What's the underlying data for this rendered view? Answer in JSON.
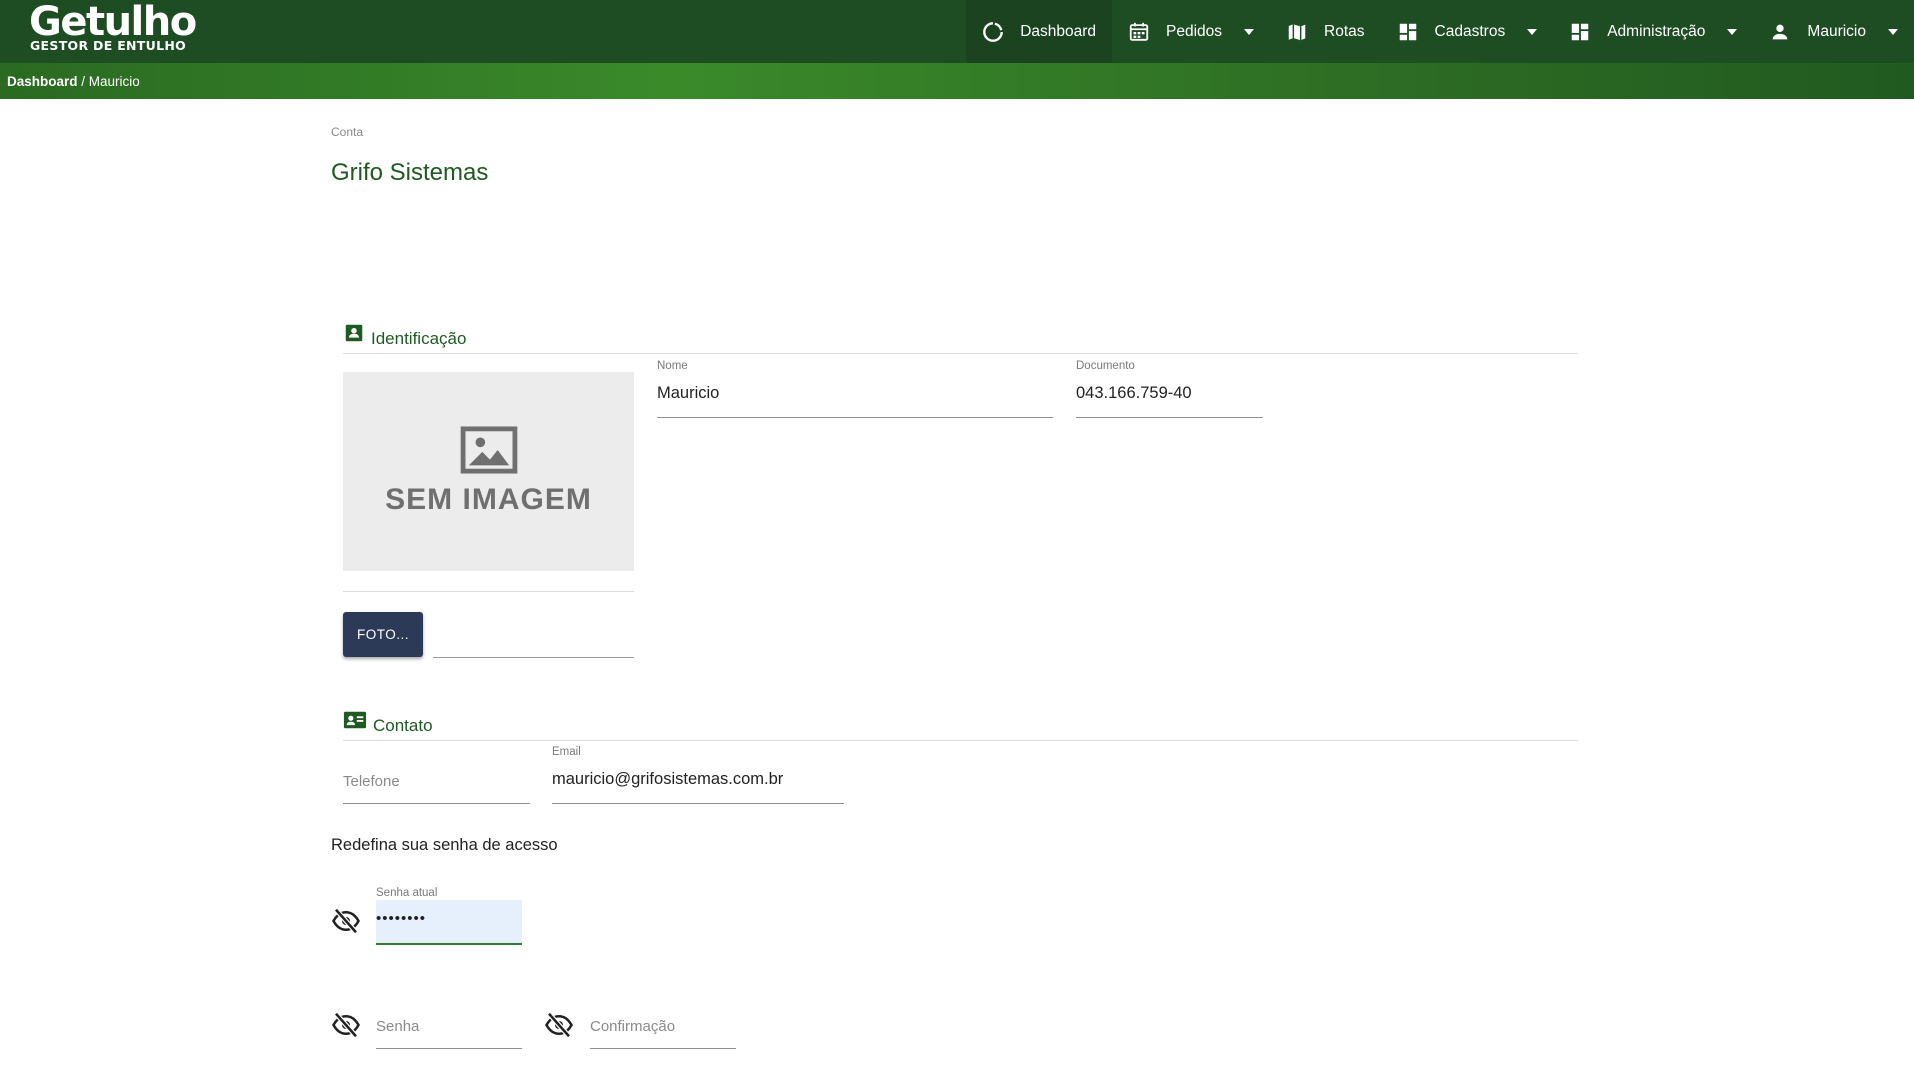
{
  "brand": {
    "title": "Getulho",
    "subtitle": "GESTOR DE ENTULHO"
  },
  "nav": [
    {
      "label": "Dashboard",
      "icon": "loading-circle-icon",
      "dropdown": false,
      "active": true
    },
    {
      "label": "Pedidos",
      "icon": "calendar-icon",
      "dropdown": true,
      "active": false
    },
    {
      "label": "Rotas",
      "icon": "map-icon",
      "dropdown": false,
      "active": false
    },
    {
      "label": "Cadastros",
      "icon": "dashboard-grid-icon",
      "dropdown": true,
      "active": false
    },
    {
      "label": "Administração",
      "icon": "dashboard-grid-icon",
      "dropdown": true,
      "active": false
    },
    {
      "label": "Mauricio",
      "icon": "user-icon",
      "dropdown": true,
      "active": false
    }
  ],
  "breadcrumb": {
    "root": "Dashboard",
    "separator": " / ",
    "current": "Mauricio"
  },
  "page": {
    "label": "Conta",
    "title": "Grifo Sistemas"
  },
  "identificacao": {
    "title": "Identificação",
    "photo_placeholder": "SEM IMAGEM",
    "photo_button": "FOTO...",
    "nome": {
      "label": "Nome",
      "value": "Mauricio"
    },
    "documento": {
      "label": "Documento",
      "value": "043.166.759-40"
    }
  },
  "contato": {
    "title": "Contato",
    "telefone": {
      "placeholder": "Telefone",
      "value": ""
    },
    "email": {
      "label": "Email",
      "value": "mauricio@grifosistemas.com.br"
    }
  },
  "senha": {
    "heading": "Redefina sua senha de acesso",
    "atual": {
      "label": "Senha atual",
      "value": "••••••••"
    },
    "nova": {
      "placeholder": "Senha"
    },
    "confirmacao": {
      "placeholder": "Confirmação"
    }
  },
  "colors": {
    "navbar": "#1f4d23",
    "accent": "#1f5a23",
    "button": "#2c3a57"
  }
}
